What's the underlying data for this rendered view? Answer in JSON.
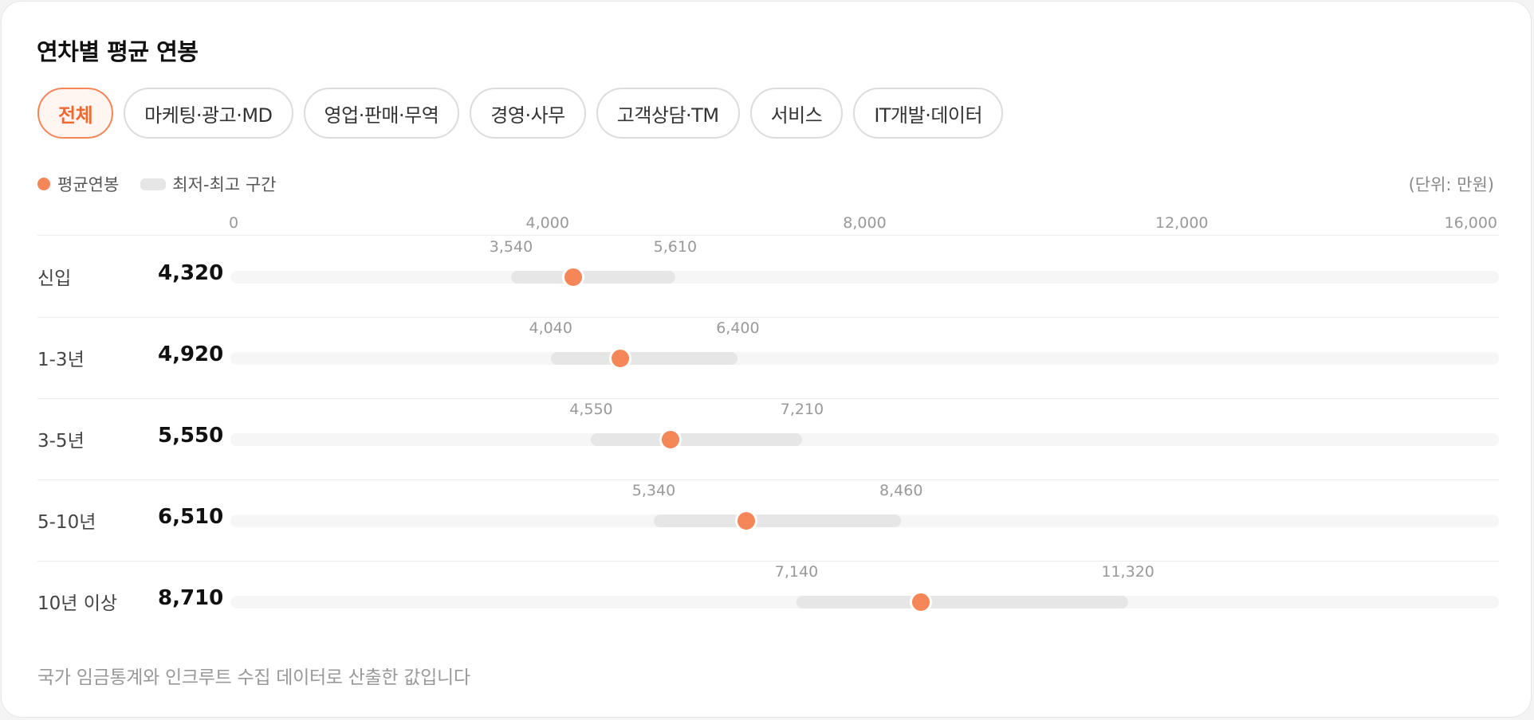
{
  "title": "연차별 평균 연봉",
  "tabs": [
    {
      "label": "전체",
      "active": true
    },
    {
      "label": "마케팅·광고·MD",
      "active": false
    },
    {
      "label": "영업·판매·무역",
      "active": false
    },
    {
      "label": "경영·사무",
      "active": false
    },
    {
      "label": "고객상담·TM",
      "active": false
    },
    {
      "label": "서비스",
      "active": false
    },
    {
      "label": "IT개발·데이터",
      "active": false
    }
  ],
  "legend": {
    "average": "평균연봉",
    "range": "최저-최고 구간"
  },
  "unit": "(단위: 만원)",
  "colors": {
    "accent": "#f58657",
    "range_bar": "#e6e6e6",
    "track": "#f6f6f7"
  },
  "chart_data": {
    "type": "range-dot",
    "x_range": [
      0,
      16000
    ],
    "x_ticks": [
      "0",
      "4,000",
      "8,000",
      "12,000",
      "16,000"
    ],
    "x_tick_values": [
      0,
      4000,
      8000,
      12000,
      16000
    ],
    "rows": [
      {
        "label": "신입",
        "avg": 4320,
        "avg_text": "4,320",
        "min": 3540,
        "min_text": "3,540",
        "max": 5610,
        "max_text": "5,610"
      },
      {
        "label": "1-3년",
        "avg": 4920,
        "avg_text": "4,920",
        "min": 4040,
        "min_text": "4,040",
        "max": 6400,
        "max_text": "6,400"
      },
      {
        "label": "3-5년",
        "avg": 5550,
        "avg_text": "5,550",
        "min": 4550,
        "min_text": "4,550",
        "max": 7210,
        "max_text": "7,210"
      },
      {
        "label": "5-10년",
        "avg": 6510,
        "avg_text": "6,510",
        "min": 5340,
        "min_text": "5,340",
        "max": 8460,
        "max_text": "8,460"
      },
      {
        "label": "10년 이상",
        "avg": 8710,
        "avg_text": "8,710",
        "min": 7140,
        "min_text": "7,140",
        "max": 11320,
        "max_text": "11,320"
      }
    ]
  },
  "footnote": "국가 임금통계와 인크루트 수집 데이터로 산출한 값입니다"
}
